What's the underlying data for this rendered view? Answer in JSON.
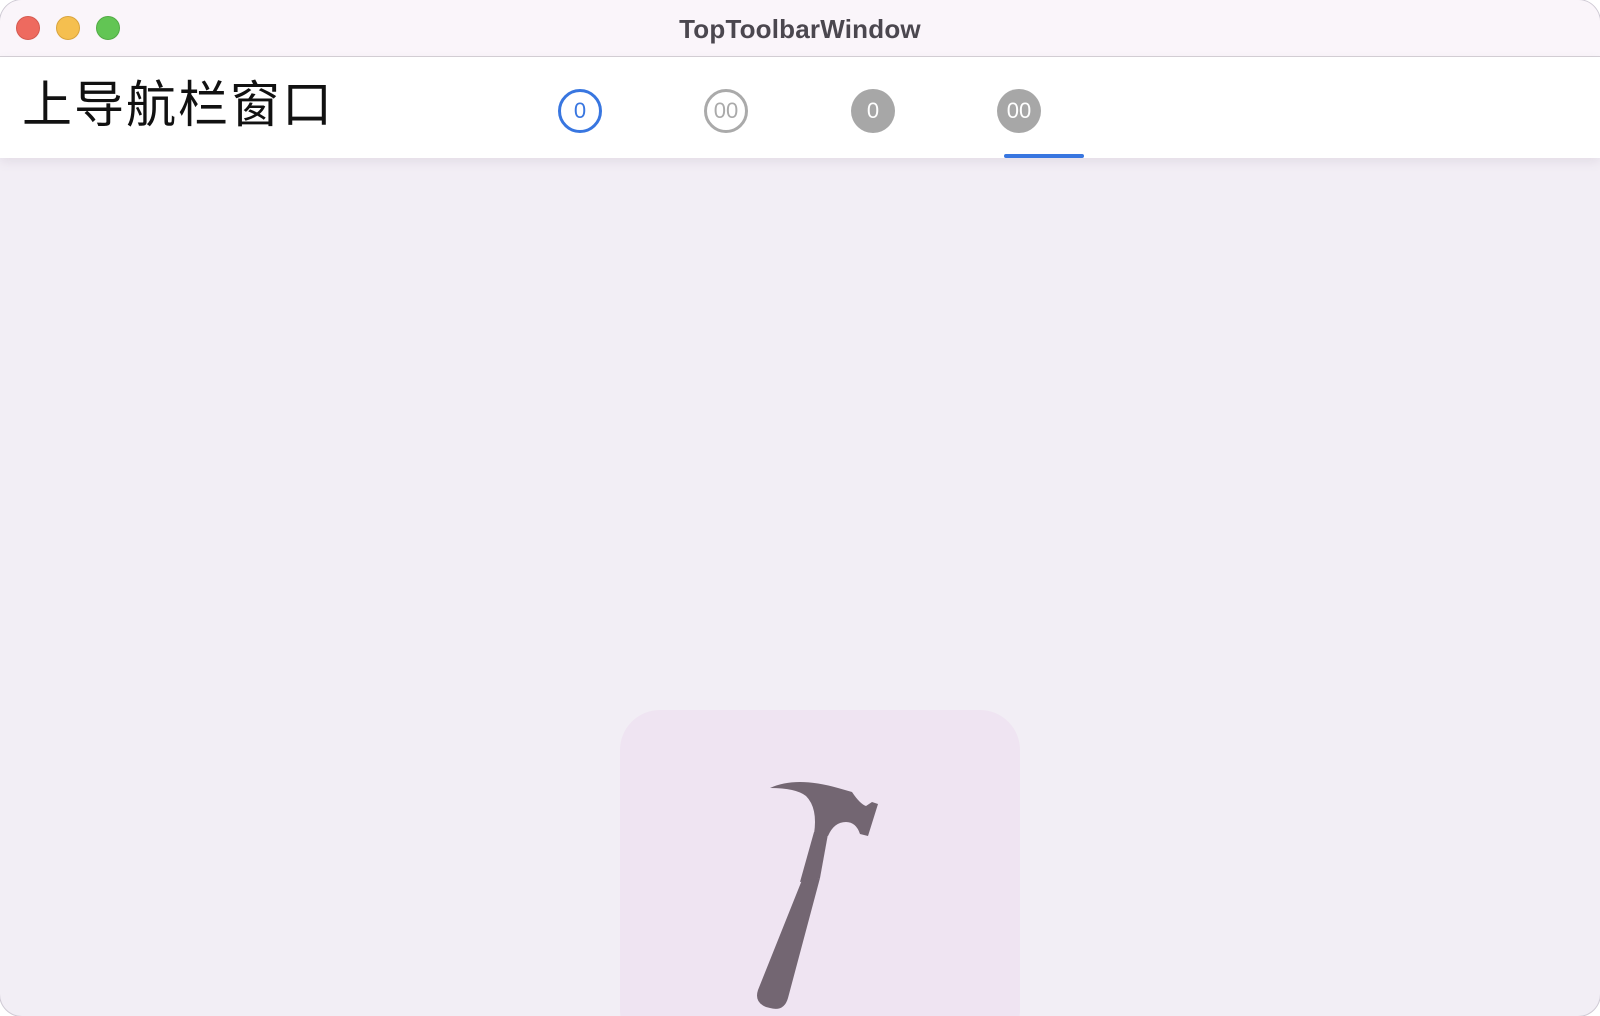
{
  "window": {
    "title": "TopToolbarWindow"
  },
  "toolbar": {
    "title": "上导航栏窗口",
    "tabs": [
      {
        "label": "0",
        "style": "outline",
        "color": "#3876e0",
        "selected": false
      },
      {
        "label": "00",
        "style": "outline",
        "color": "#aaaaaa",
        "selected": false
      },
      {
        "label": "0",
        "style": "filled",
        "color": "#a7a7a7",
        "selected": false
      },
      {
        "label": "00",
        "style": "filled",
        "color": "#a7a7a7",
        "selected": true
      }
    ],
    "indicator_color": "#3876e0"
  },
  "content": {
    "icon": "hammer-icon",
    "background": "#f2eef5"
  }
}
